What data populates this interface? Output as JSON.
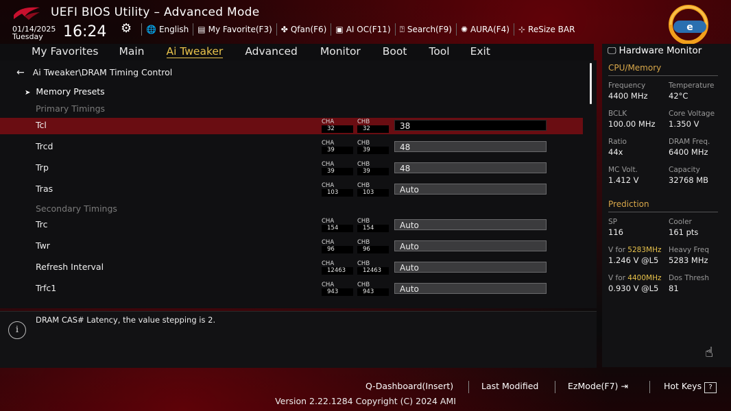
{
  "header": {
    "title": "UEFI BIOS Utility – Advanced Mode",
    "date": "01/14/2025",
    "day": "Tuesday",
    "time": "16:24",
    "tools": [
      {
        "icon": "globe-icon",
        "glyph": "🌐",
        "label": "English"
      },
      {
        "icon": "favorite-icon",
        "glyph": "▤",
        "label": "My Favorite(F3)"
      },
      {
        "icon": "fan-icon",
        "glyph": "✤",
        "label": "Qfan(F6)"
      },
      {
        "icon": "ai-chip-icon",
        "glyph": "▣",
        "label": "AI OC(F11)"
      },
      {
        "icon": "search-icon",
        "glyph": "⍰",
        "label": "Search(F9)"
      },
      {
        "icon": "aura-icon",
        "glyph": "✺",
        "label": "AURA(F4)"
      },
      {
        "icon": "resize-bar-icon",
        "glyph": "⊹",
        "label": "ReSize BAR"
      }
    ]
  },
  "tabs": [
    "My Favorites",
    "Main",
    "Ai Tweaker",
    "Advanced",
    "Monitor",
    "Boot",
    "Tool",
    "Exit"
  ],
  "active_tab": "Ai Tweaker",
  "breadcrumb": "Ai Tweaker\\DRAM Timing Control",
  "preset": "Memory Presets",
  "sections": {
    "primary": "Primary Timings",
    "secondary": "Secondary Timings"
  },
  "channel_labels": {
    "a": "CHA",
    "b": "CHB"
  },
  "timings": [
    {
      "label": "Tcl",
      "cha": "32",
      "chb": "32",
      "value": "38"
    },
    {
      "label": "Trcd",
      "cha": "39",
      "chb": "39",
      "value": "48"
    },
    {
      "label": "Trp",
      "cha": "39",
      "chb": "39",
      "value": "48"
    },
    {
      "label": "Tras",
      "cha": "103",
      "chb": "103",
      "value": "Auto"
    },
    {
      "label": "Trc",
      "cha": "154",
      "chb": "154",
      "value": "Auto"
    },
    {
      "label": "Twr",
      "cha": "96",
      "chb": "96",
      "value": "Auto"
    },
    {
      "label": "Refresh Interval",
      "cha": "12463",
      "chb": "12463",
      "value": "Auto"
    },
    {
      "label": "Trfc1",
      "cha": "943",
      "chb": "943",
      "value": "Auto"
    }
  ],
  "help": "DRAM CAS# Latency, the value stepping is 2.",
  "hw": {
    "title": "Hardware Monitor",
    "cpu_section": "CPU/Memory",
    "cpu": [
      {
        "label": "Frequency",
        "value": "4400 MHz"
      },
      {
        "label": "Temperature",
        "value": "42°C"
      },
      {
        "label": "BCLK",
        "value": "100.00 MHz"
      },
      {
        "label": "Core Voltage",
        "value": "1.350 V"
      },
      {
        "label": "Ratio",
        "value": "44x"
      },
      {
        "label": "DRAM Freq.",
        "value": "6400 MHz"
      },
      {
        "label": "MC Volt.",
        "value": "1.412 V"
      },
      {
        "label": "Capacity",
        "value": "32768 MB"
      }
    ],
    "pred_section": "Prediction",
    "pred": {
      "sp_label": "SP",
      "sp_value": "116",
      "cooler_label": "Cooler",
      "cooler_value": "161 pts",
      "v1_prefix": "V for ",
      "v1_freq": "5283MHz",
      "v1_value": "1.246 V @L5",
      "heavy_label": "Heavy Freq",
      "heavy_value": "5283 MHz",
      "v2_prefix": "V for ",
      "v2_freq": "4400MHz",
      "v2_value": "0.930 V @L5",
      "dos_label": "Dos Thresh",
      "dos_value": "81"
    }
  },
  "footer": {
    "qdash": "Q-Dashboard(Insert)",
    "last": "Last Modified",
    "ez": "EzMode(F7)",
    "hotkeys": "Hot Keys",
    "hotkeys_key": "?",
    "version": "Version 2.22.1284 Copyright (C) 2024 AMI"
  },
  "colors": {
    "accent": "#e9c34b",
    "selected_row": "#6a0d12",
    "prediction": "#d9a84a"
  }
}
